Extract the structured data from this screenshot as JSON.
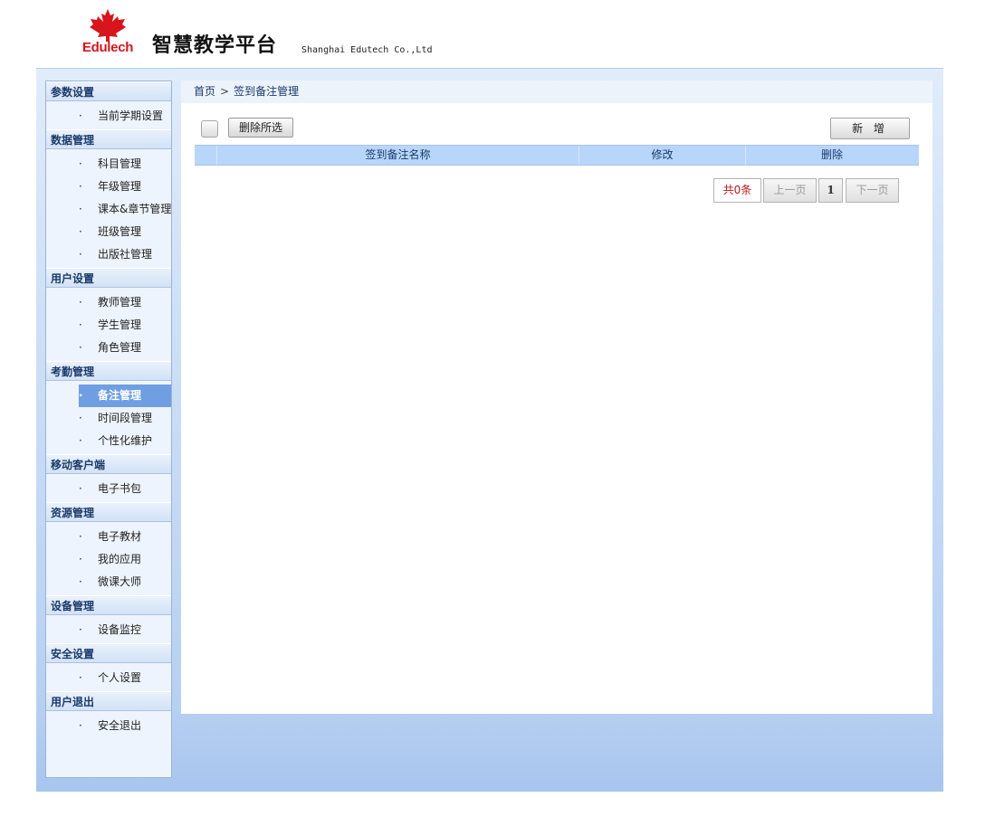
{
  "header": {
    "logo_text": "Edulech",
    "platform_title": "智慧教学平台",
    "company": "Shanghai Edutech Co.,Ltd",
    "brand_color": "#d8141c"
  },
  "sidebar": {
    "groups": [
      {
        "title": "参数设置",
        "items": [
          "当前学期设置"
        ]
      },
      {
        "title": "数据管理",
        "items": [
          "科目管理",
          "年级管理",
          "课本&章节管理",
          "班级管理",
          "出版社管理"
        ]
      },
      {
        "title": "用户设置",
        "items": [
          "教师管理",
          "学生管理",
          "角色管理"
        ]
      },
      {
        "title": "考勤管理",
        "items": [
          "备注管理",
          "时间段管理",
          "个性化维护"
        ]
      },
      {
        "title": "移动客户端",
        "items": [
          "电子书包"
        ]
      },
      {
        "title": "资源管理",
        "items": [
          "电子教材",
          "我的应用",
          "微课大师"
        ]
      },
      {
        "title": "设备管理",
        "items": [
          "设备监控"
        ]
      },
      {
        "title": "安全设置",
        "items": [
          "个人设置"
        ]
      },
      {
        "title": "用户退出",
        "items": [
          "安全退出"
        ]
      }
    ],
    "active_item": "备注管理",
    "bullet": "·",
    "active_color": "#6f9ee2"
  },
  "breadcrumb": {
    "home": "首页",
    "separator": ">",
    "current": "签到备注管理"
  },
  "toolbar": {
    "delete_selected_label": "删除所选",
    "add_label": "新 增"
  },
  "table": {
    "columns": [
      "",
      "签到备注名称",
      "修改",
      "删除"
    ],
    "rows": []
  },
  "pagination": {
    "total_label": "共0条",
    "prev_label": "上一页",
    "current_page": "1",
    "next_label": "下一页"
  }
}
